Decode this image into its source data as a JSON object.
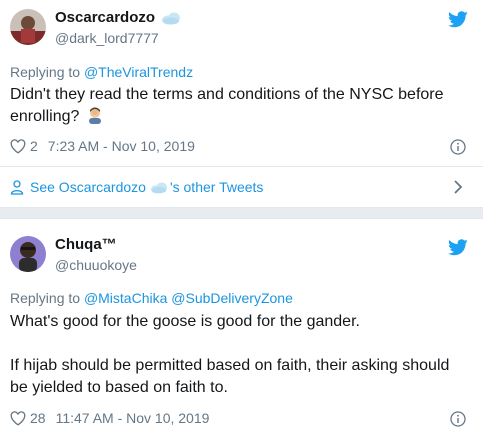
{
  "tweet1": {
    "display_name": "Oscarcardozo",
    "handle": "@dark_lord7777",
    "replying_prefix": "Replying to ",
    "replying_to": "@TheViralTrendz",
    "text": "Didn't they read the terms and conditions of the NYSC before enrolling?",
    "likes": "2",
    "timestamp": "7:23 AM - Nov 10, 2019",
    "see_more_prefix": "See Oscarcardozo",
    "see_more_suffix": "'s other Tweets"
  },
  "tweet2": {
    "display_name": "Chuqa™",
    "handle": "@chuuokoye",
    "replying_prefix": "Replying to ",
    "replying_to": "@MistaChika @SubDeliveryZone",
    "text_line1": "What's good for the goose is good for the gander.",
    "text_line2": "If hijab should be permitted based on faith, their asking should be yielded to based on faith to.",
    "likes": "28",
    "timestamp": "11:47 AM - Nov 10, 2019"
  },
  "colors": {
    "twitter_blue": "#1da1f2",
    "link": "#1b95e0",
    "muted": "#657786",
    "text": "#14171a"
  },
  "icons": [
    "cloud-emoji",
    "twitter-bird-icon",
    "heart-icon",
    "info-icon",
    "person-icon",
    "chevron-right-icon",
    "man-facepalming-emoji"
  ]
}
